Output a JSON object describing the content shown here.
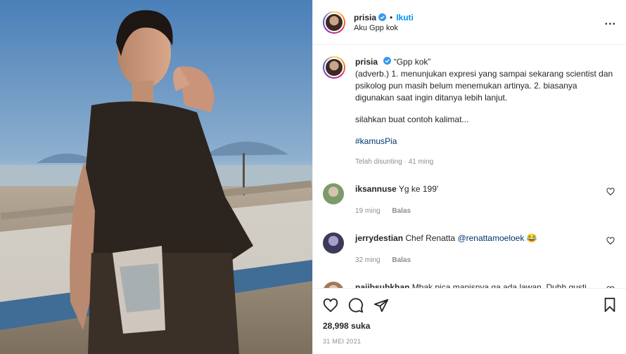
{
  "post": {
    "username": "prisia",
    "follow_label": "Ikuti",
    "dot": "•",
    "location": "Aku Gpp kok",
    "more_label": "..."
  },
  "caption": {
    "username": "prisia",
    "title": "“Gpp kok”",
    "body": "(adverb.) 1. menunjukan expresi yang sampai sekarang scientist dan psikolog pun masih belum menemukan artinya. 2. biasanya digunakan saat ingin ditanya lebih lanjut.",
    "body2": "silahkan buat contoh kalimat...",
    "hashtag": "#kamusPia",
    "meta": "Telah disunting · 41 ming"
  },
  "comments": [
    {
      "username": "iksannuse",
      "text": "Yg ke 199'",
      "time": "19 ming",
      "reply": "Balas",
      "avatar_color": "#7a9c6a"
    },
    {
      "username": "jerrydestian",
      "text": "Chef Renatta ",
      "mention": "@renattamoeloek",
      "emoji": "😂",
      "time": "32 ming",
      "reply": "Balas",
      "avatar_color": "#3b3a5a"
    },
    {
      "username": "naiibsubkhan",
      "text": "Mbak pica manisnya ga ada lawan. Duhh gusti",
      "time": "",
      "reply": "",
      "avatar_color": "#a07a5a"
    }
  ],
  "footer": {
    "likes": "28,998 suka",
    "date": "31 MEI 2021"
  },
  "icons": {
    "like": "heart-icon",
    "comment": "comment-icon",
    "share": "share-icon",
    "save": "bookmark-icon"
  },
  "colors": {
    "follow": "#0095f6",
    "verified": "#3897f0",
    "hashtag": "#00376b",
    "muted": "#8e8e8e"
  }
}
